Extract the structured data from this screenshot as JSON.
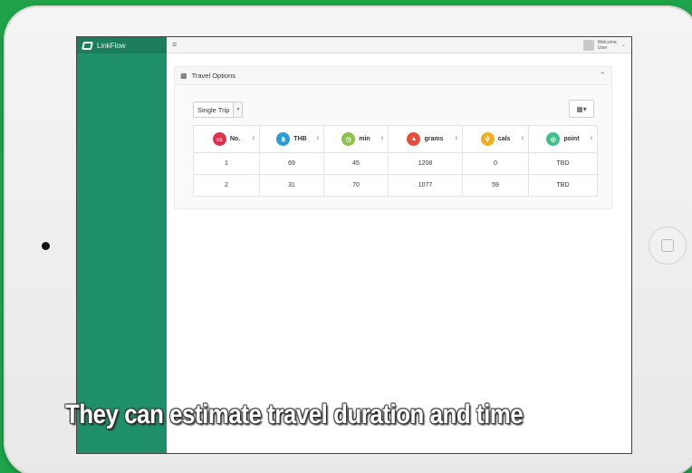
{
  "app": {
    "brand": "LinkFlow"
  },
  "topbar": {
    "menu_icon": "hamburger-icon",
    "welcome": "Welcome,",
    "user": "User"
  },
  "panel": {
    "title": "Travel Options",
    "grid_icon": "grid-icon",
    "collapse_icon": "chevron-up-icon"
  },
  "controls": {
    "trip_type": "Single Trip",
    "column_toggle_icon": "columns-icon"
  },
  "table": {
    "columns": [
      {
        "label": "No.",
        "icon": "bus-icon",
        "color": "#e0314b",
        "glyph": "▭"
      },
      {
        "label": "THB",
        "icon": "baht-icon",
        "color": "#2b9ad8",
        "glyph": "฿"
      },
      {
        "label": "min",
        "icon": "clock-icon",
        "color": "#8bc34a",
        "glyph": "◷"
      },
      {
        "label": "grams",
        "icon": "flame-icon",
        "color": "#e74c3c",
        "glyph": "▲"
      },
      {
        "label": "cals",
        "icon": "energy-icon",
        "color": "#f0ad1c",
        "glyph": "ψ"
      },
      {
        "label": "point",
        "icon": "target-icon",
        "color": "#3fbf8a",
        "glyph": "◎"
      }
    ],
    "rows": [
      [
        "1",
        "69",
        "45",
        "1208",
        "0",
        "TBD"
      ],
      [
        "2",
        "31",
        "70",
        "1077",
        "59",
        "TBD"
      ]
    ]
  },
  "caption": "They can estimate travel duration and time"
}
